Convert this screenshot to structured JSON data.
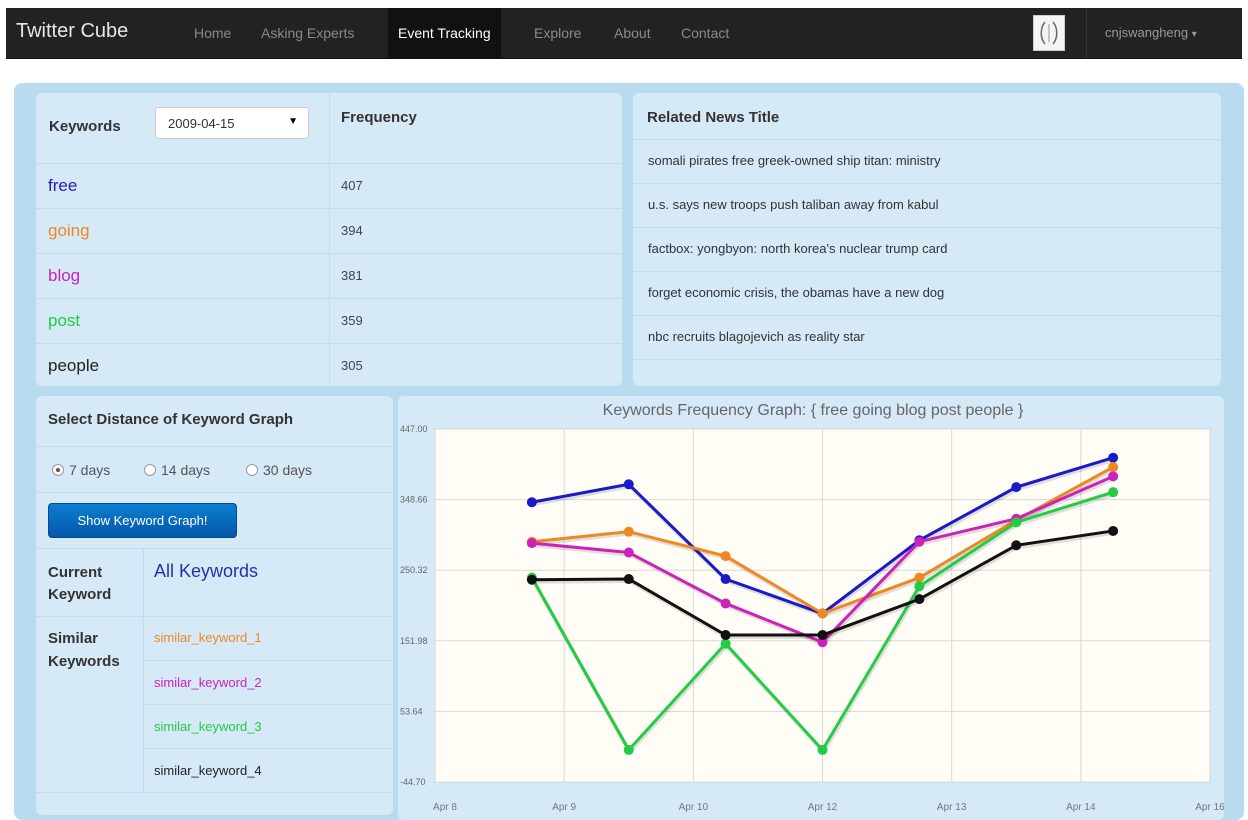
{
  "navbar": {
    "brand": "Twitter Cube",
    "links": [
      "Home",
      "Asking Experts",
      "Event Tracking",
      "Explore",
      "About",
      "Contact"
    ],
    "active": "Event Tracking",
    "user": "cnjswangheng",
    "user_caret": "▾"
  },
  "keywords_table": {
    "header_keywords": "Keywords",
    "date_selected": "2009-04-15",
    "select_arrow": "▼",
    "header_frequency": "Frequency",
    "rows": [
      {
        "keyword": "free",
        "frequency": "407",
        "color": "#2222bb"
      },
      {
        "keyword": "going",
        "frequency": "394",
        "color": "#ee8822"
      },
      {
        "keyword": "blog",
        "frequency": "381",
        "color": "#cc22bb"
      },
      {
        "keyword": "post",
        "frequency": "359",
        "color": "#22cc44"
      },
      {
        "keyword": "people",
        "frequency": "305",
        "color": "#222222"
      }
    ]
  },
  "news": {
    "header": "Related News Title",
    "items": [
      "somali pirates free greek-owned ship titan: ministry",
      "u.s. says new troops push taliban away from kabul",
      "factbox: yongbyon: north korea's nuclear trump card",
      "forget economic crisis, the obamas have a new dog",
      "nbc recruits blagojevich as reality star"
    ]
  },
  "distance": {
    "header": "Select Distance of Keyword Graph",
    "options": [
      "7 days",
      "14 days",
      "30 days"
    ],
    "selected": "7 days",
    "button": "Show Keyword Graph!"
  },
  "current_keyword": {
    "label_line1": "Current",
    "label_line2": "Keyword",
    "value": "All Keywords"
  },
  "similar_keywords": {
    "label_line1": "Similar",
    "label_line2": "Keywords",
    "items": [
      {
        "text": "similar_keyword_1",
        "color": "#ee8822"
      },
      {
        "text": "similar_keyword_2",
        "color": "#cc22bb"
      },
      {
        "text": "similar_keyword_3",
        "color": "#22cc44"
      },
      {
        "text": "similar_keyword_4",
        "color": "#222222"
      }
    ]
  },
  "chart_data": {
    "type": "line",
    "title": "Keywords Frequency Graph: { free going blog post people }",
    "x_ticks": [
      "Apr 8",
      "Apr 9",
      "Apr 10",
      "Apr 12",
      "Apr 13",
      "Apr 14",
      "Apr 16"
    ],
    "y_ticks": [
      "447.00",
      "348.66",
      "250.32",
      "151.98",
      "53.64",
      "-44.70"
    ],
    "ylim": [
      -44.7,
      447.0
    ],
    "x": [
      0.75,
      1.5,
      2.25,
      3.0,
      3.75,
      4.5,
      5.25
    ],
    "xlim": [
      0,
      6
    ],
    "grid": true,
    "series": [
      {
        "name": "free",
        "color": "#1a1ac8",
        "values": [
          345,
          370,
          238,
          190,
          292,
          366,
          407
        ]
      },
      {
        "name": "going",
        "color": "#ee8822",
        "values": [
          290,
          304,
          270,
          190,
          240,
          320,
          394
        ]
      },
      {
        "name": "blog",
        "color": "#cc22bb",
        "values": [
          288,
          275,
          204,
          150,
          290,
          322,
          381
        ]
      },
      {
        "name": "post",
        "color": "#22cc44",
        "values": [
          240,
          0,
          148,
          0,
          228,
          317,
          359
        ]
      },
      {
        "name": "people",
        "color": "#111111",
        "values": [
          237,
          238,
          160,
          160,
          210,
          285,
          305
        ]
      }
    ]
  }
}
